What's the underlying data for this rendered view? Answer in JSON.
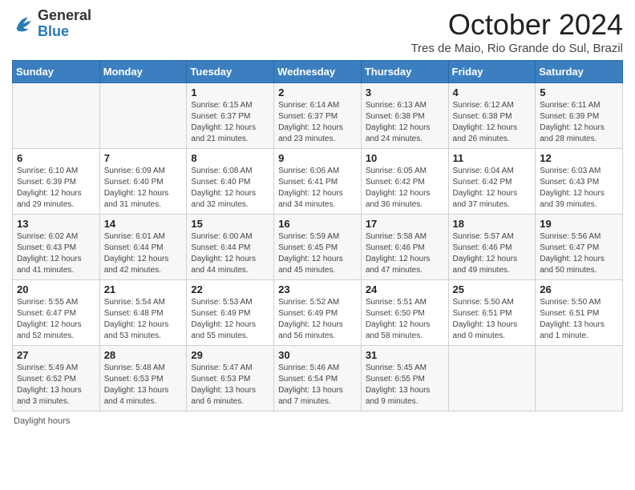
{
  "header": {
    "logo_general": "General",
    "logo_blue": "Blue",
    "month_title": "October 2024",
    "location": "Tres de Maio, Rio Grande do Sul, Brazil"
  },
  "columns": [
    "Sunday",
    "Monday",
    "Tuesday",
    "Wednesday",
    "Thursday",
    "Friday",
    "Saturday"
  ],
  "weeks": [
    [
      {
        "day": "",
        "sunrise": "",
        "sunset": "",
        "daylight": ""
      },
      {
        "day": "",
        "sunrise": "",
        "sunset": "",
        "daylight": ""
      },
      {
        "day": "1",
        "sunrise": "Sunrise: 6:15 AM",
        "sunset": "Sunset: 6:37 PM",
        "daylight": "Daylight: 12 hours and 21 minutes."
      },
      {
        "day": "2",
        "sunrise": "Sunrise: 6:14 AM",
        "sunset": "Sunset: 6:37 PM",
        "daylight": "Daylight: 12 hours and 23 minutes."
      },
      {
        "day": "3",
        "sunrise": "Sunrise: 6:13 AM",
        "sunset": "Sunset: 6:38 PM",
        "daylight": "Daylight: 12 hours and 24 minutes."
      },
      {
        "day": "4",
        "sunrise": "Sunrise: 6:12 AM",
        "sunset": "Sunset: 6:38 PM",
        "daylight": "Daylight: 12 hours and 26 minutes."
      },
      {
        "day": "5",
        "sunrise": "Sunrise: 6:11 AM",
        "sunset": "Sunset: 6:39 PM",
        "daylight": "Daylight: 12 hours and 28 minutes."
      }
    ],
    [
      {
        "day": "6",
        "sunrise": "Sunrise: 6:10 AM",
        "sunset": "Sunset: 6:39 PM",
        "daylight": "Daylight: 12 hours and 29 minutes."
      },
      {
        "day": "7",
        "sunrise": "Sunrise: 6:09 AM",
        "sunset": "Sunset: 6:40 PM",
        "daylight": "Daylight: 12 hours and 31 minutes."
      },
      {
        "day": "8",
        "sunrise": "Sunrise: 6:08 AM",
        "sunset": "Sunset: 6:40 PM",
        "daylight": "Daylight: 12 hours and 32 minutes."
      },
      {
        "day": "9",
        "sunrise": "Sunrise: 6:06 AM",
        "sunset": "Sunset: 6:41 PM",
        "daylight": "Daylight: 12 hours and 34 minutes."
      },
      {
        "day": "10",
        "sunrise": "Sunrise: 6:05 AM",
        "sunset": "Sunset: 6:42 PM",
        "daylight": "Daylight: 12 hours and 36 minutes."
      },
      {
        "day": "11",
        "sunrise": "Sunrise: 6:04 AM",
        "sunset": "Sunset: 6:42 PM",
        "daylight": "Daylight: 12 hours and 37 minutes."
      },
      {
        "day": "12",
        "sunrise": "Sunrise: 6:03 AM",
        "sunset": "Sunset: 6:43 PM",
        "daylight": "Daylight: 12 hours and 39 minutes."
      }
    ],
    [
      {
        "day": "13",
        "sunrise": "Sunrise: 6:02 AM",
        "sunset": "Sunset: 6:43 PM",
        "daylight": "Daylight: 12 hours and 41 minutes."
      },
      {
        "day": "14",
        "sunrise": "Sunrise: 6:01 AM",
        "sunset": "Sunset: 6:44 PM",
        "daylight": "Daylight: 12 hours and 42 minutes."
      },
      {
        "day": "15",
        "sunrise": "Sunrise: 6:00 AM",
        "sunset": "Sunset: 6:44 PM",
        "daylight": "Daylight: 12 hours and 44 minutes."
      },
      {
        "day": "16",
        "sunrise": "Sunrise: 5:59 AM",
        "sunset": "Sunset: 6:45 PM",
        "daylight": "Daylight: 12 hours and 45 minutes."
      },
      {
        "day": "17",
        "sunrise": "Sunrise: 5:58 AM",
        "sunset": "Sunset: 6:46 PM",
        "daylight": "Daylight: 12 hours and 47 minutes."
      },
      {
        "day": "18",
        "sunrise": "Sunrise: 5:57 AM",
        "sunset": "Sunset: 6:46 PM",
        "daylight": "Daylight: 12 hours and 49 minutes."
      },
      {
        "day": "19",
        "sunrise": "Sunrise: 5:56 AM",
        "sunset": "Sunset: 6:47 PM",
        "daylight": "Daylight: 12 hours and 50 minutes."
      }
    ],
    [
      {
        "day": "20",
        "sunrise": "Sunrise: 5:55 AM",
        "sunset": "Sunset: 6:47 PM",
        "daylight": "Daylight: 12 hours and 52 minutes."
      },
      {
        "day": "21",
        "sunrise": "Sunrise: 5:54 AM",
        "sunset": "Sunset: 6:48 PM",
        "daylight": "Daylight: 12 hours and 53 minutes."
      },
      {
        "day": "22",
        "sunrise": "Sunrise: 5:53 AM",
        "sunset": "Sunset: 6:49 PM",
        "daylight": "Daylight: 12 hours and 55 minutes."
      },
      {
        "day": "23",
        "sunrise": "Sunrise: 5:52 AM",
        "sunset": "Sunset: 6:49 PM",
        "daylight": "Daylight: 12 hours and 56 minutes."
      },
      {
        "day": "24",
        "sunrise": "Sunrise: 5:51 AM",
        "sunset": "Sunset: 6:50 PM",
        "daylight": "Daylight: 12 hours and 58 minutes."
      },
      {
        "day": "25",
        "sunrise": "Sunrise: 5:50 AM",
        "sunset": "Sunset: 6:51 PM",
        "daylight": "Daylight: 13 hours and 0 minutes."
      },
      {
        "day": "26",
        "sunrise": "Sunrise: 5:50 AM",
        "sunset": "Sunset: 6:51 PM",
        "daylight": "Daylight: 13 hours and 1 minute."
      }
    ],
    [
      {
        "day": "27",
        "sunrise": "Sunrise: 5:49 AM",
        "sunset": "Sunset: 6:52 PM",
        "daylight": "Daylight: 13 hours and 3 minutes."
      },
      {
        "day": "28",
        "sunrise": "Sunrise: 5:48 AM",
        "sunset": "Sunset: 6:53 PM",
        "daylight": "Daylight: 13 hours and 4 minutes."
      },
      {
        "day": "29",
        "sunrise": "Sunrise: 5:47 AM",
        "sunset": "Sunset: 6:53 PM",
        "daylight": "Daylight: 13 hours and 6 minutes."
      },
      {
        "day": "30",
        "sunrise": "Sunrise: 5:46 AM",
        "sunset": "Sunset: 6:54 PM",
        "daylight": "Daylight: 13 hours and 7 minutes."
      },
      {
        "day": "31",
        "sunrise": "Sunrise: 5:45 AM",
        "sunset": "Sunset: 6:55 PM",
        "daylight": "Daylight: 13 hours and 9 minutes."
      },
      {
        "day": "",
        "sunrise": "",
        "sunset": "",
        "daylight": ""
      },
      {
        "day": "",
        "sunrise": "",
        "sunset": "",
        "daylight": ""
      }
    ]
  ],
  "footer": {
    "daylight_label": "Daylight hours"
  }
}
